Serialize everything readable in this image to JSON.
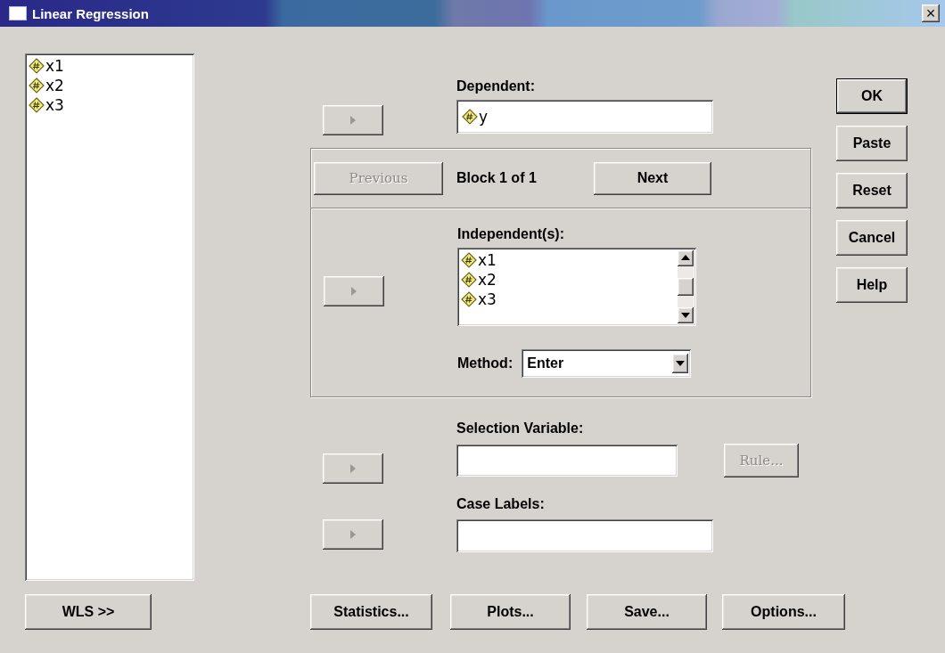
{
  "window": {
    "title": "Linear Regression",
    "close": "×"
  },
  "source_variables": [
    {
      "name": "x1"
    },
    {
      "name": "x2"
    },
    {
      "name": "x3"
    }
  ],
  "dependent": {
    "label": "Dependent:",
    "variables": [
      {
        "name": "y"
      }
    ]
  },
  "block": {
    "previous": {
      "label": "Previous",
      "disabled": true
    },
    "status": "Block 1 of 1",
    "next": {
      "label": "Next",
      "disabled": false
    }
  },
  "independents": {
    "label": "Independent(s):",
    "variables": [
      {
        "name": "x1"
      },
      {
        "name": "x2"
      },
      {
        "name": "x3"
      }
    ]
  },
  "method": {
    "label": "Method:",
    "value": "Enter"
  },
  "selection_variable": {
    "label": "Selection Variable:",
    "rule": {
      "label": "Rule...",
      "disabled": true
    }
  },
  "case_labels": {
    "label": "Case Labels:"
  },
  "side_buttons": [
    {
      "label": "OK",
      "default": true
    },
    {
      "label": "Paste",
      "default": false
    },
    {
      "label": "Reset",
      "default": false
    },
    {
      "label": "Cancel",
      "default": false
    },
    {
      "label": "Help",
      "default": false
    }
  ],
  "bottom_buttons": [
    {
      "label": "WLS >>"
    },
    {
      "label": "Statistics..."
    },
    {
      "label": "Plots..."
    },
    {
      "label": "Save..."
    },
    {
      "label": "Options..."
    }
  ]
}
